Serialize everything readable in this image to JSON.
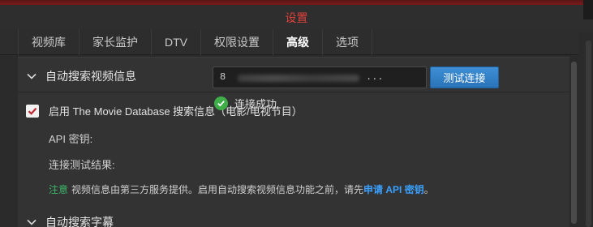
{
  "dialog": {
    "title": "设置"
  },
  "tabs": [
    {
      "label": "视频库"
    },
    {
      "label": "家长监护"
    },
    {
      "label": "DTV"
    },
    {
      "label": "权限设置"
    },
    {
      "label": "高级",
      "active": true
    },
    {
      "label": "选项"
    }
  ],
  "section_video": {
    "title": "自动搜索视频信息",
    "enable_label": "启用 The Movie Database 搜索信息（电影/电视节目）",
    "enable_checked": true,
    "api_key_label": "API 密钥:",
    "api_key_value_start": "8",
    "api_key_value_end": "...",
    "test_button": "测试连接",
    "result_label": "连接测试结果:",
    "result_status": "连接成功",
    "note_tag": "注意",
    "note_text": "视频信息由第三方服务提供。启用自动搜索视频信息功能之前，请先",
    "note_link": "申请 API 密钥",
    "note_end": "。"
  },
  "section_subtitle": {
    "title": "自动搜索字幕"
  },
  "colors": {
    "accent_title": "#e0403a",
    "button": "#2f7fc6",
    "success": "#3fae49",
    "note_tag": "#3eb86a",
    "link": "#3aa0ff"
  },
  "icons": [
    "chevron-down-icon",
    "check-icon",
    "success-check-icon"
  ]
}
